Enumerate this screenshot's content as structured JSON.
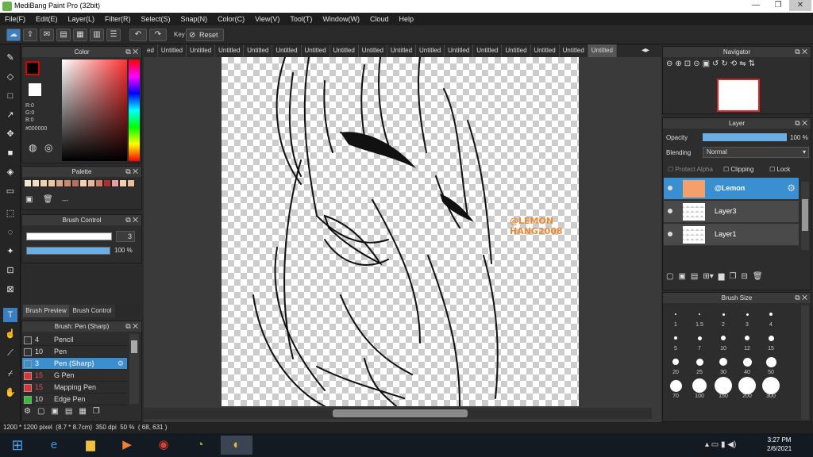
{
  "window": {
    "title": "MediBang Paint Pro (32bit)",
    "min": "—",
    "max": "❐",
    "close": "✕"
  },
  "menu": [
    "File(F)",
    "Edit(E)",
    "Layer(L)",
    "Filter(R)",
    "Select(S)",
    "Snap(N)",
    "Color(C)",
    "View(V)",
    "Tool(T)",
    "Window(W)",
    "Cloud",
    "Help"
  ],
  "toolbar": {
    "key_label": "Key",
    "reset_label": "Reset"
  },
  "tabs": [
    "ed",
    "Untitled",
    "Untitled",
    "Untitled",
    "Untitled",
    "Untitled",
    "Untitled",
    "Untitled",
    "Untitled",
    "Untitled",
    "Untitled",
    "Untitled",
    "Untitled",
    "Untitled",
    "Untitled",
    "Untitled",
    "Untitled"
  ],
  "color_panel": {
    "title": "Color",
    "r": "R:0",
    "g": "G:0",
    "b": "B:0",
    "hex": "#000000",
    "main_color": "#000000"
  },
  "palette": {
    "title": "Palette",
    "dash": "---",
    "swatches": [
      "#f5e6d0",
      "#f3dcc4",
      "#efd0b0",
      "#f0c7a5",
      "#d9a58b",
      "#c88a6e",
      "#b4705c",
      "#f3cfb4",
      "#e8b89a",
      "#c97b63",
      "#a83232",
      "#e4a0a0",
      "#f5d0b0",
      "#e8c0a0"
    ]
  },
  "brush_control": {
    "title": "Brush Control",
    "size": "3",
    "opacity": "100 %",
    "size_fraction": 0.98,
    "opacity_fraction": 1.0
  },
  "brush_tabs": {
    "preview": "Brush Preview",
    "control": "Brush Control"
  },
  "brush_list": {
    "title": "Brush: Pen (Sharp)",
    "items": [
      {
        "size": "4",
        "name": "Pencil",
        "color": "#333333"
      },
      {
        "size": "10",
        "name": "Pen",
        "color": "#333333"
      },
      {
        "size": "3",
        "name": "Pen (Sharp)",
        "color": "#3a8fd1"
      },
      {
        "size": "15",
        "name": "G Pen",
        "color": "#e03030"
      },
      {
        "size": "15",
        "name": "Mapping Pen",
        "color": "#e03030"
      },
      {
        "size": "10",
        "name": "Edge Pen",
        "color": "#30c030"
      }
    ]
  },
  "navigator": {
    "title": "Navigator"
  },
  "layer_panel": {
    "title": "Layer",
    "opacity_label": "Opacity",
    "opacity_value": "100 %",
    "blending_label": "Blending",
    "blending_value": "Normal",
    "protect_alpha": "Protect Alpha",
    "clipping": "Clipping",
    "lock": "Lock",
    "layers": [
      {
        "name": "@Lemon"
      },
      {
        "name": "Layer3"
      },
      {
        "name": "Layer1"
      }
    ]
  },
  "brush_size": {
    "title": "Brush Size",
    "sizes": [
      "1",
      "1.5",
      "2",
      "3",
      "4",
      "5",
      "7",
      "10",
      "12",
      "15",
      "20",
      "25",
      "30",
      "40",
      "50",
      "70",
      "100",
      "150",
      "200",
      "300"
    ]
  },
  "canvas": {
    "watermark_line1": "@LEMON",
    "watermark_line2": "HANG2008",
    "watermark_color": "#f08a30"
  },
  "status": {
    "pixels": "1200 * 1200 pixel",
    "cm": "(8.7 * 8.7cm)",
    "dpi": "350 dpi",
    "zoom": "50 %",
    "coords": "( 68, 631 )"
  },
  "taskbar": {
    "time": "3:27 PM",
    "date": "2/6/2021"
  }
}
